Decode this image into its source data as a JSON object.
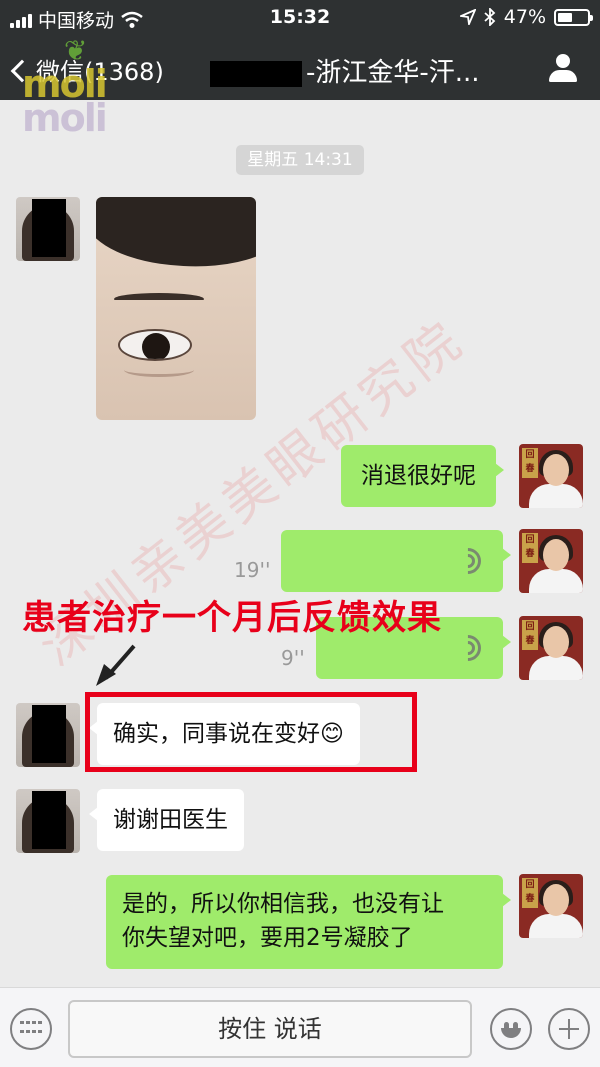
{
  "status_bar": {
    "carrier": "中国移动",
    "time": "15:32",
    "battery": "47%"
  },
  "nav": {
    "back_label": "微信(1368)",
    "title": "-浙江金华-汗..."
  },
  "timestamp": "星期五 14:31",
  "messages": {
    "doc1": "消退很好呢",
    "voice1_duration": "19''",
    "voice2_duration": "9''",
    "patient1": "确实，同事说在变好😊",
    "patient2": "谢谢田医生",
    "doc2_line1": "是的，所以你相信我，也没有让",
    "doc2_line2": "你失望对吧，要用2号凝胶了"
  },
  "annotation": "患者治疗一个月后反馈效果",
  "input_bar": {
    "hold_to_talk": "按住 说话"
  },
  "colors": {
    "bubble_green": "#9feb6b",
    "annotation_red": "#e8001a",
    "nav_dark": "#2e3132"
  },
  "icons": [
    "signal-icon",
    "wifi-icon",
    "location-icon",
    "bluetooth-icon",
    "battery-icon",
    "back-chevron-icon",
    "person-icon",
    "voice-wave-icon",
    "keyboard-icon",
    "emoji-icon",
    "plus-icon"
  ]
}
